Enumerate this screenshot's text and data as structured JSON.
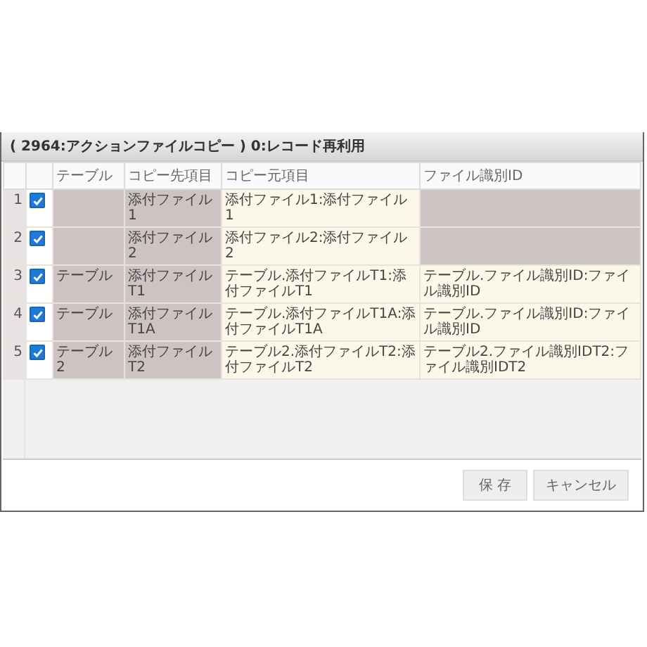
{
  "dialog": {
    "title": "( 2964:アクションファイルコピー ) 0:レコード再利用"
  },
  "table": {
    "columns": [
      "テーブル",
      "コピー先項目",
      "コピー元項目",
      "ファイル識別ID"
    ],
    "rows": [
      {
        "number": "1",
        "checked": true,
        "dest": "添付ファイル1",
        "source": "添付ファイル1:添付ファイル1"
      },
      {
        "number": "2",
        "checked": true,
        "dest": "添付ファイル2",
        "source": "添付ファイル2:添付ファイル2"
      },
      {
        "number": "3",
        "checked": true,
        "table": "テーブル",
        "dest": "添付ファイルT1",
        "source": "テーブル.添付ファイルT1:添付ファイルT1",
        "file_id": "テーブル.ファイル識別ID:ファイル識別ID"
      },
      {
        "number": "4",
        "checked": true,
        "table": "テーブル",
        "dest": "添付ファイルT1A",
        "source": "テーブル.添付ファイルT1A:添付ファイルT1A",
        "file_id": "テーブル.ファイル識別ID:ファイル識別ID"
      },
      {
        "number": "5",
        "checked": true,
        "table": "テーブル2",
        "dest": "添付ファイルT2",
        "source": "テーブル2.添付ファイルT2:添付ファイルT2",
        "file_id": "テーブル2.ファイル識別IDT2:ファイル識別IDT2"
      }
    ]
  },
  "buttons": [
    {
      "label": "保 存",
      "kind": "save"
    },
    {
      "label": "キャンセル",
      "kind": "cancel"
    }
  ]
}
